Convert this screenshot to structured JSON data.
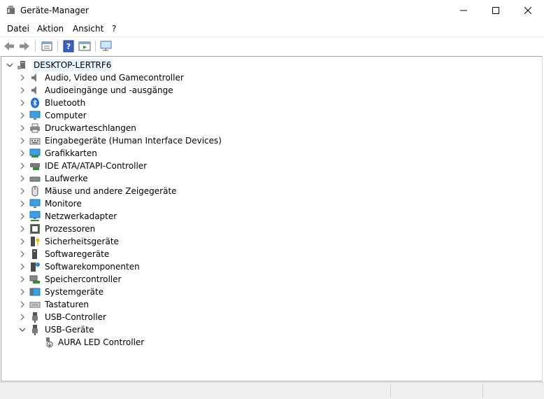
{
  "window": {
    "title": "Geräte-Manager"
  },
  "menu": [
    "Datei",
    "Aktion",
    "Ansicht",
    "?"
  ],
  "toolbar": {
    "buttons": [
      "back-arrow-icon",
      "forward-arrow-icon",
      "properties-icon",
      "help-icon",
      "run-icon",
      "monitor-scan-icon"
    ]
  },
  "tree": {
    "root": "DESKTOP-LERTRF6",
    "categories": [
      "Audio, Video und Gamecontroller",
      "Audioeingänge und -ausgänge",
      "Bluetooth",
      "Computer",
      "Druckwarteschlangen",
      "Eingabegeräte (Human Interface Devices)",
      "Grafikkarten",
      "IDE ATA/ATAPI-Controller",
      "Laufwerke",
      "Mäuse und andere Zeigegeräte",
      "Monitore",
      "Netzwerkadapter",
      "Prozessoren",
      "Sicherheitsgeräte",
      "Softwaregeräte",
      "Softwarekomponenten",
      "Speichercontroller",
      "Systemgeräte",
      "Tastaturen",
      "USB-Controller",
      "USB-Geräte"
    ],
    "expanded_category": "USB-Geräte",
    "child": "AURA LED Controller"
  }
}
